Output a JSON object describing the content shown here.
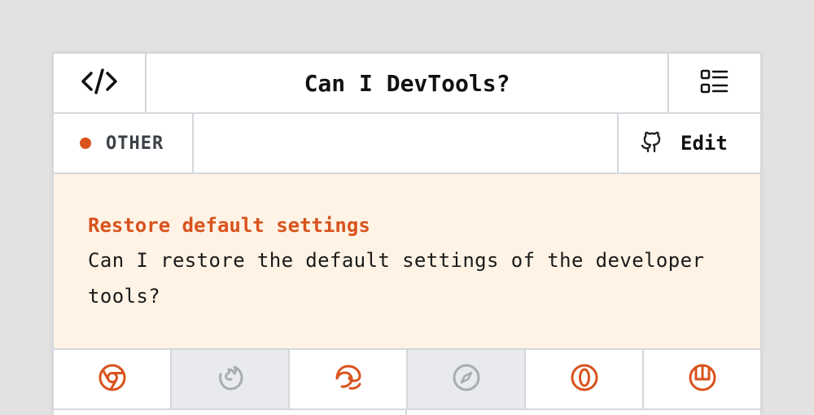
{
  "header": {
    "title": "Can I DevTools?",
    "logo_icon": "code-icon",
    "menu_icon": "list-icon"
  },
  "category": {
    "label": "OTHER",
    "dot_color": "#d9531e"
  },
  "edit": {
    "label": "Edit",
    "icon": "github-icon"
  },
  "feature": {
    "title": "Restore default settings",
    "description_line1": "Can I restore the default settings of the developer",
    "description_line2": "tools?"
  },
  "browsers": [
    {
      "name": "chrome",
      "icon": "chrome-icon",
      "supported": true
    },
    {
      "name": "firefox",
      "icon": "firefox-icon",
      "supported": false
    },
    {
      "name": "edge",
      "icon": "edge-icon",
      "supported": true
    },
    {
      "name": "safari",
      "icon": "safari-icon",
      "supported": false
    },
    {
      "name": "opera",
      "icon": "opera-icon",
      "supported": true
    },
    {
      "name": "polypane",
      "icon": "polypane-icon",
      "supported": true
    }
  ],
  "colors": {
    "accent": "#d9531e",
    "unsupported_icon": "#a9acb0",
    "feature_bg": "#fff3e5"
  }
}
